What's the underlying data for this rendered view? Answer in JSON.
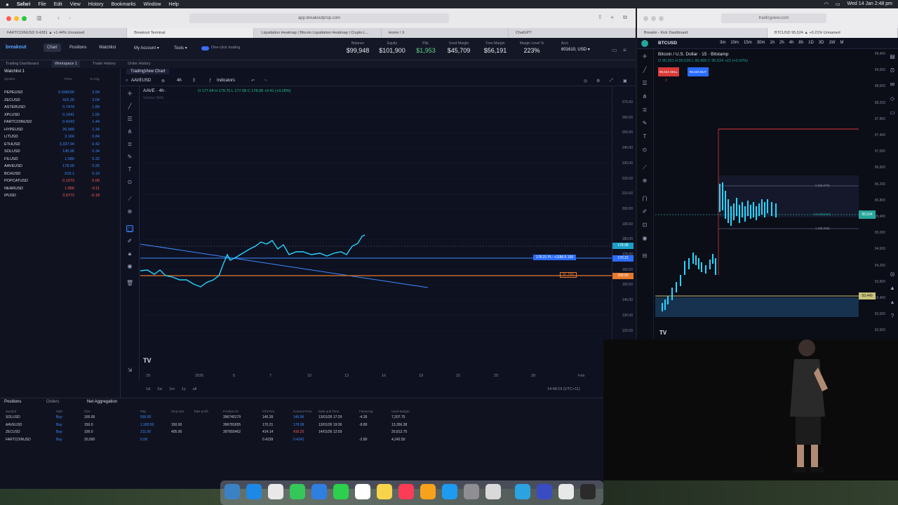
{
  "menubar": {
    "apple": "",
    "items": [
      "Safari",
      "File",
      "Edit",
      "View",
      "History",
      "Bookmarks",
      "Window",
      "Help"
    ],
    "clock": "Wed 14 Jan 2:48 pm"
  },
  "browser": {
    "url": "app.breakoutprop.com",
    "tabs": [
      "FARTCOINUSD 0.4281 ▲ +1.44% Unnamed",
      "Breakout Terminal",
      "Liquidation Heatmap | Bitcoin Liquidation Heatmap | Crypto L...",
      "Home / X",
      "ChatGPT"
    ]
  },
  "app": {
    "logo": "breakout",
    "nav": [
      "Chart",
      "Positions",
      "Watchlist"
    ],
    "nav_active": "Chart",
    "menus": [
      "My Account",
      "Tools"
    ],
    "one_click": "One-click trading",
    "metrics": [
      {
        "label": "Balance",
        "value": "$99,948",
        "color": "#e8eaf2"
      },
      {
        "label": "Equity",
        "value": "$101,900",
        "color": "#e8eaf2"
      },
      {
        "label": "P&L",
        "value": "$1,953",
        "color": "#5fd38a"
      },
      {
        "label": "Used Margin",
        "value": "$45,709",
        "color": "#e8eaf2"
      },
      {
        "label": "Free Margin",
        "value": "$56,191",
        "color": "#e8eaf2"
      },
      {
        "label": "Margin Level %",
        "value": "223%",
        "color": "#e8eaf2"
      }
    ],
    "account": {
      "label": "Acct",
      "value": "601610, USD ▾"
    },
    "subnav": [
      "Trading Dashboard",
      "Workspace 1",
      "Trade History",
      "Order History"
    ],
    "watchlist_title": "Watchlist 1",
    "watch_headers": [
      "Symbol",
      "Price",
      "% Chg"
    ],
    "watchlist": [
      {
        "sym": "PEPEUSD",
        "price": "0.006630",
        "chg": "3.94",
        "up": true
      },
      {
        "sym": "ZECUSD",
        "price": "416.26",
        "chg": "3.04",
        "up": true
      },
      {
        "sym": "ASTERUSD",
        "price": "0.7474",
        "chg": "1.89",
        "up": true
      },
      {
        "sym": "XPLUSD",
        "price": "0.1641",
        "chg": "1.55",
        "up": true
      },
      {
        "sym": "FARTCOINUSD",
        "price": "0.4243",
        "chg": "1.44",
        "up": true
      },
      {
        "sym": "HYPEUSD",
        "price": "26.089",
        "chg": "1.34",
        "up": true
      },
      {
        "sym": "LITUSD",
        "price": "2.166",
        "chg": "0.84",
        "up": true
      },
      {
        "sym": "ETHUSD",
        "price": "3,337.94",
        "chg": "0.42",
        "up": true
      },
      {
        "sym": "SOLUSD",
        "price": "145.96",
        "chg": "0.34",
        "up": true
      },
      {
        "sym": "FILUSD",
        "price": "1.580",
        "chg": "0.32",
        "up": true
      },
      {
        "sym": "AAVEUSD",
        "price": "178.09",
        "chg": "0.25",
        "up": true
      },
      {
        "sym": "BCHUSD",
        "price": "618.1",
        "chg": "0.19",
        "up": true
      },
      {
        "sym": "POPCATUSD",
        "price": "0.1072",
        "chg": "0.00",
        "up": false
      },
      {
        "sym": "NEARUSD",
        "price": "1.856",
        "chg": "-0.11",
        "up": false
      },
      {
        "sym": "IPUSD",
        "price": "3.9772",
        "chg": "-0.18",
        "up": false
      }
    ],
    "chart": {
      "tab": "TradingView Chart",
      "symbol": "AAVEUSD",
      "interval": "4h",
      "indicators": "Indicators",
      "legend": "AAVE · 4h ·",
      "ohlc": "O 177.04  H 179.70  L 177.08  C 178.08  +0.41 (+0.28%)",
      "volume": "Volume  SMA",
      "yticks": [
        "270.00",
        "260.00",
        "250.00",
        "240.00",
        "230.00",
        "220.00",
        "210.00",
        "200.00",
        "190.00",
        "180.00",
        "170.00",
        "160.00",
        "150.00",
        "140.00",
        "130.00",
        "120.00"
      ],
      "xticks": [
        "29",
        "2026",
        "5",
        "7",
        "10",
        "13",
        "16",
        "19",
        "22",
        "25",
        "28",
        "Feb"
      ],
      "price_tag_current": "178.08",
      "price_tag_entry": "170.21",
      "price_tag_sl": "159.00",
      "pl_label": "178.21 PL: +1186.5  150",
      "sl_label": "SL  150",
      "timeframes": [
        "1d",
        "1w",
        "1m",
        "1y",
        "all"
      ],
      "time": "14:48:19 (UTC+11)"
    },
    "positions": {
      "tabs": [
        "Positions",
        "Orders",
        "Net Aggregation"
      ],
      "headers": [
        "Symbol",
        "Side",
        "Size",
        "P&L",
        "Stop loss",
        "Take profit",
        "Position ID",
        "Fill Price",
        "Current Price",
        "Date and Time",
        "Financing",
        "Used Margin"
      ],
      "rows": [
        [
          "SOLUSD",
          "Buy",
          "100.00",
          "556.00",
          "",
          "",
          "396740179",
          "140.39",
          "145.95",
          "13/01/26 17:29",
          "-4.35",
          "7,207.75"
        ],
        [
          "AAVEUSD",
          "Buy",
          "150.0",
          "1,180.50",
          "150.00",
          "",
          "396781655",
          "170.21",
          "178.08",
          "13/01/26 19:36",
          "-8.89",
          "13,356.38"
        ],
        [
          "ZECUSD",
          "Buy",
          "100.0",
          "211.00",
          "405.00",
          "",
          "397655462",
          "414.14",
          "416.25",
          "14/01/26 12:59",
          "",
          "20,812.75"
        ],
        [
          "FARTCOINUSD",
          "Buy",
          "20,000",
          "5.08",
          "",
          "",
          "",
          "0.4239",
          "0.4242",
          "",
          "-2.80",
          "4,242.50"
        ]
      ]
    }
  },
  "right": {
    "url": "tradingview.com",
    "tabs": [
      "Breakin - Kick Dashboard",
      "BTCUSD 95,524 ▲ +0.21% Unnamed"
    ],
    "symbol_short": "BTCUSD",
    "intervals": [
      "3m",
      "10m",
      "15m",
      "30m",
      "1h",
      "2h",
      "4h",
      "8h",
      "1D",
      "3D",
      "1W",
      "M"
    ],
    "title": "Bitcoin / U.S. Dollar · 15 · Bitstamp",
    "ohlc": "O 95,501  H 95,529  L 95,499  C 95,524  +22 (+0.02%)",
    "sell": "95,524 SELL",
    "buy": "95,526 BUY",
    "qty": "3",
    "yticks": [
      "99,400",
      "99,000",
      "98,600",
      "98,200",
      "97,800",
      "97,400",
      "97,000",
      "96,600",
      "96,200",
      "95,800",
      "95,400",
      "95,000",
      "94,600",
      "94,200",
      "93,800",
      "93,400",
      "93,000",
      "92,600"
    ],
    "fib": [
      "0 (96,070)",
      "0.5 (95,524)",
      "1 (95,025)"
    ],
    "price_tag": "95,524",
    "level_tag": "93,440"
  },
  "colors": {
    "up": "#3a86ff",
    "down": "#ff5a5a",
    "line": "#26d6ff",
    "orange": "#e8792c",
    "blue_tl": "#3b8cff",
    "red": "#d83a3a"
  }
}
